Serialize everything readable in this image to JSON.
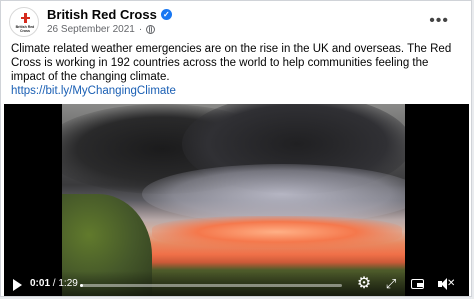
{
  "post": {
    "page_name": "British Red Cross",
    "date": "26 September 2021",
    "avatar_text": "British Red Cross",
    "text": "Climate related weather emergencies are on the rise in the UK and overseas. The Red Cross is working in 192 countries across the world to help communities feeling the impact of the changing climate.",
    "link": "https://bit.ly/MyChangingClimate"
  },
  "video": {
    "current_time": "0:01",
    "separator": "/",
    "duration": "1:29",
    "progress_fraction": 0.011
  },
  "icons": {
    "verified": "verified-badge-icon",
    "privacy": "globe-icon",
    "more": "more-options-icon",
    "play": "play-icon",
    "settings": "gear-icon",
    "fullscreen": "expand-icon",
    "pip": "picture-in-picture-icon",
    "mute": "muted-speaker-icon"
  },
  "colors": {
    "brand_red": "#d52b1e",
    "link": "#1a5fb4",
    "verified": "#1877f2"
  }
}
